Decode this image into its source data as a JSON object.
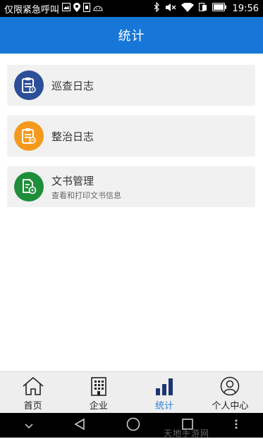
{
  "statusbar": {
    "carrier_text": "仅限紧急呼叫",
    "time": "19:56"
  },
  "header": {
    "title": "统计"
  },
  "list": [
    {
      "title": "巡查日志",
      "subtitle": "",
      "icon": "clipboard-icon",
      "color": "#2d4e98"
    },
    {
      "title": "整治日志",
      "subtitle": "",
      "icon": "clipboard-icon",
      "color": "#f39a1e"
    },
    {
      "title": "文书管理",
      "subtitle": "查看和打印文书信息",
      "icon": "document-gear-icon",
      "color": "#1f8e3a"
    }
  ],
  "bottomnav": {
    "items": [
      {
        "label": "首页",
        "icon": "home-icon",
        "active": false
      },
      {
        "label": "企业",
        "icon": "building-icon",
        "active": false
      },
      {
        "label": "统计",
        "icon": "bar-chart-icon",
        "active": true
      },
      {
        "label": "个人中心",
        "icon": "person-icon",
        "active": false
      }
    ]
  },
  "watermark": "天地手游网",
  "colors": {
    "primary": "#1777d8",
    "active_nav": "#2a7fd4"
  }
}
